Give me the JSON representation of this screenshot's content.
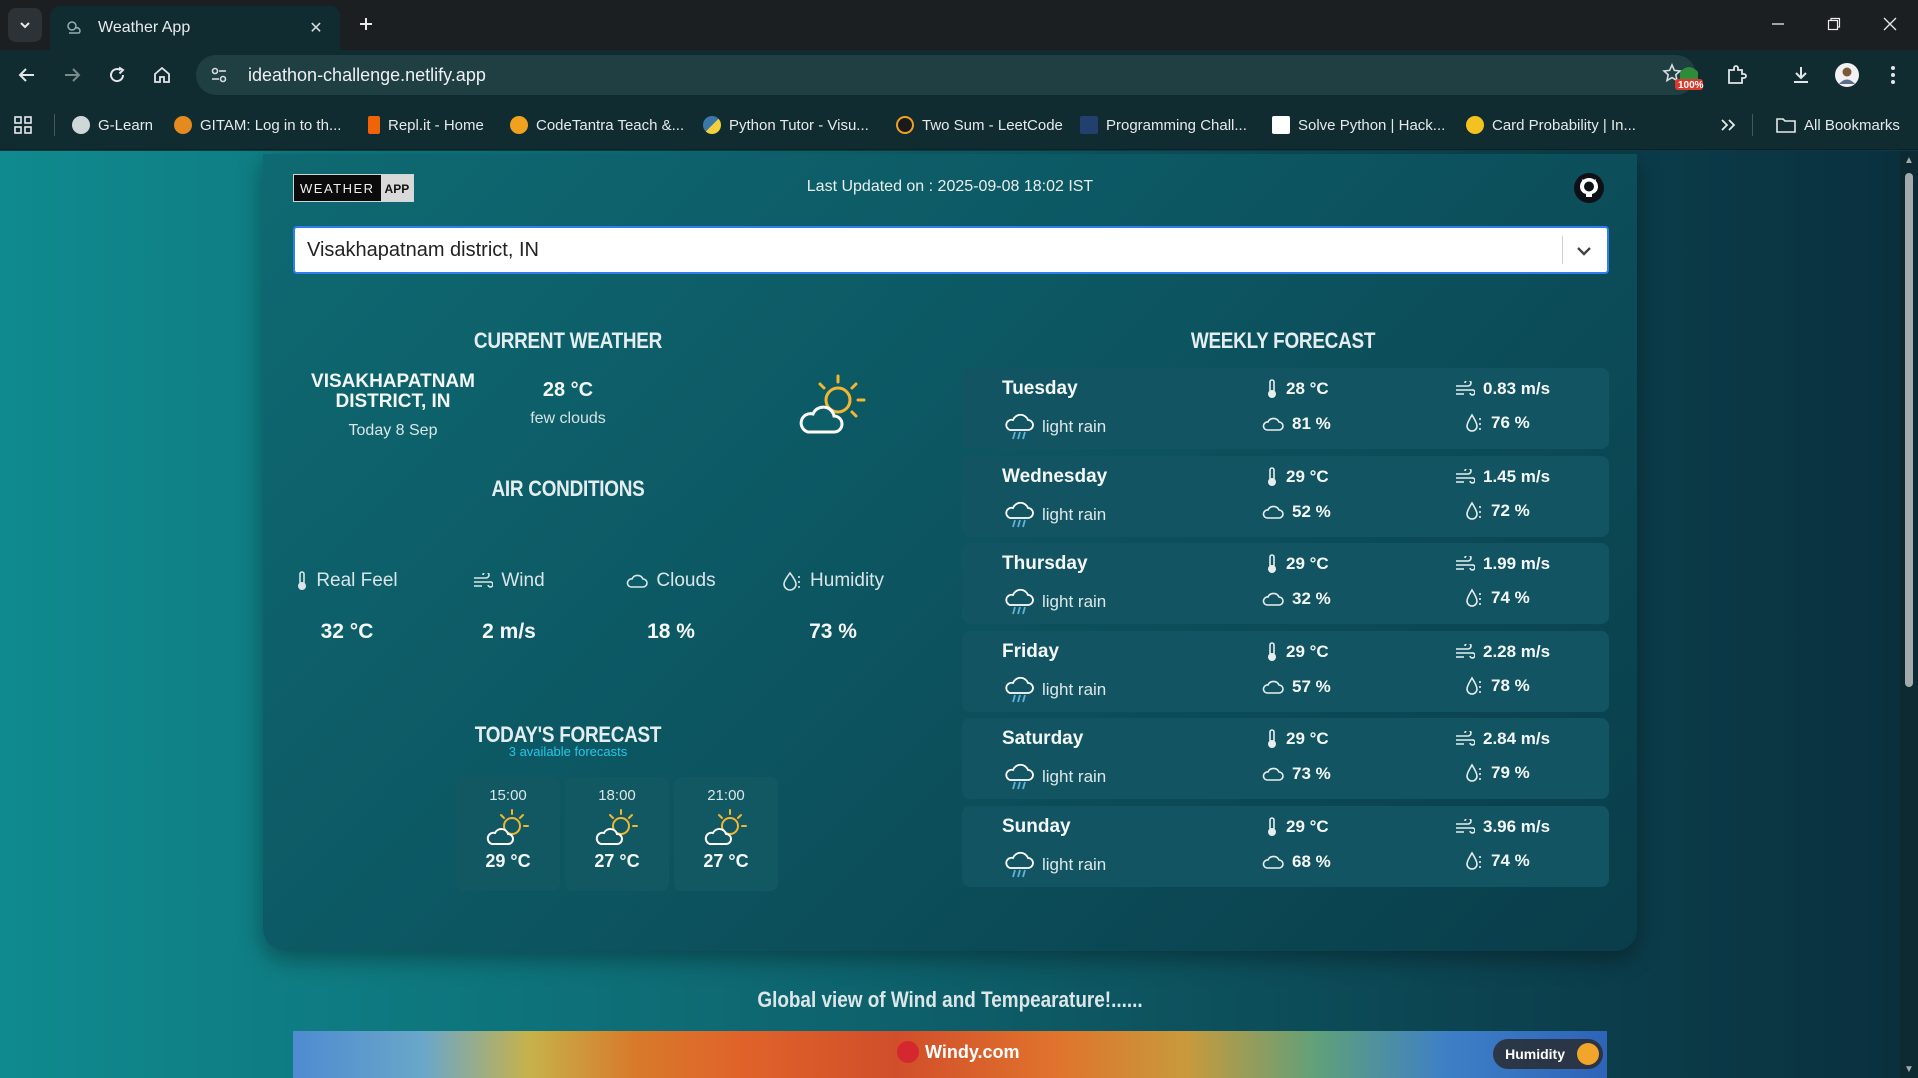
{
  "browser": {
    "tab_title": "Weather App",
    "url": "ideathon-challenge.netlify.app",
    "bookmarks": [
      "G-Learn",
      "GITAM: Log in to th...",
      "Repl.it - Home",
      "CodeTantra Teach &...",
      "Python Tutor - Visu...",
      "Two Sum - LeetCode",
      "Programming Chall...",
      "Solve Python | Hack...",
      "Card Probability | In..."
    ],
    "all_bookmarks": "All Bookmarks",
    "extension_badge": "100%"
  },
  "header": {
    "logo_left": "WEATHER",
    "logo_right": "APP",
    "last_updated": "Last Updated on : 2025-09-08 18:02 IST"
  },
  "search": {
    "selected": "Visakhapatnam district, IN"
  },
  "current": {
    "title": "CURRENT WEATHER",
    "city": "VISAKHAPATNAM DISTRICT, IN",
    "date": "Today 8 Sep",
    "temp": "28 °C",
    "desc": "few clouds"
  },
  "air": {
    "title": "AIR CONDITIONS",
    "items": [
      {
        "label": "Real Feel",
        "value": "32 °C"
      },
      {
        "label": "Wind",
        "value": "2 m/s"
      },
      {
        "label": "Clouds",
        "value": "18 %"
      },
      {
        "label": "Humidity",
        "value": "73 %"
      }
    ]
  },
  "today": {
    "title": "TODAY'S FORECAST",
    "subtitle": "3 available forecasts",
    "items": [
      {
        "time": "15:00",
        "temp": "29 °C"
      },
      {
        "time": "18:00",
        "temp": "27 °C"
      },
      {
        "time": "21:00",
        "temp": "27 °C"
      }
    ]
  },
  "weekly": {
    "title": "WEEKLY FORECAST",
    "days": [
      {
        "day": "Tuesday",
        "desc": "light rain",
        "temp": "28 °C",
        "clouds": "81 %",
        "wind": "0.83 m/s",
        "humidity": "76 %"
      },
      {
        "day": "Wednesday",
        "desc": "light rain",
        "temp": "29 °C",
        "clouds": "52 %",
        "wind": "1.45 m/s",
        "humidity": "72 %"
      },
      {
        "day": "Thursday",
        "desc": "light rain",
        "temp": "29 °C",
        "clouds": "32 %",
        "wind": "1.99 m/s",
        "humidity": "74 %"
      },
      {
        "day": "Friday",
        "desc": "light rain",
        "temp": "29 °C",
        "clouds": "57 %",
        "wind": "2.28 m/s",
        "humidity": "78 %"
      },
      {
        "day": "Saturday",
        "desc": "light rain",
        "temp": "29 °C",
        "clouds": "73 %",
        "wind": "2.84 m/s",
        "humidity": "79 %"
      },
      {
        "day": "Sunday",
        "desc": "light rain",
        "temp": "29 °C",
        "clouds": "68 %",
        "wind": "3.96 m/s",
        "humidity": "74 %"
      }
    ]
  },
  "global": {
    "title": "Global view of Wind and Tempearature!......",
    "windy_label": "Windy.com",
    "layer_label": "Humidity"
  },
  "colors": {
    "accent": "#25c7e8",
    "card": "#0c5460",
    "sun": "#f2b631"
  }
}
